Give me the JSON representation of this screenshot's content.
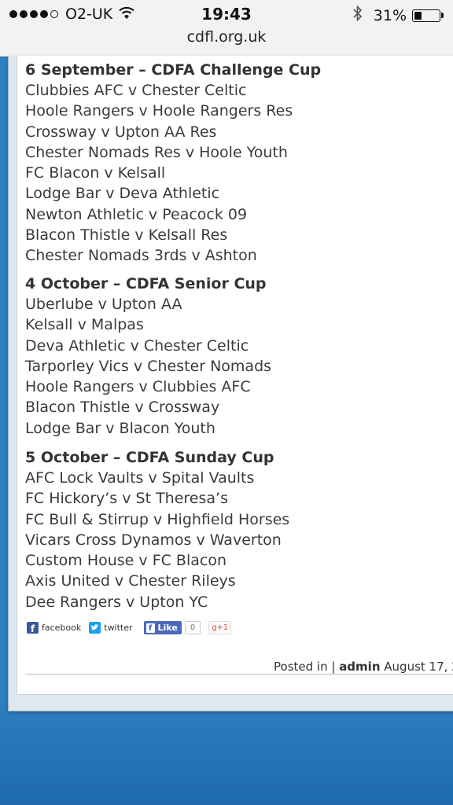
{
  "status_bar": {
    "carrier": "O2-UK",
    "signal_bars_filled": 4,
    "signal_bars_total": 5,
    "time": "19:43",
    "battery": "31%",
    "battery_level": 0.31
  },
  "browser": {
    "url": "cdfl.org.uk"
  },
  "fixtures": [
    {
      "heading": "6 September – CDFA Challenge Cup",
      "matches": [
        "Clubbies AFC v Chester Celtic",
        "Hoole Rangers v Hoole Rangers Res",
        "Crossway v Upton AA Res",
        "Chester Nomads Res v Hoole Youth",
        "FC Blacon v Kelsall",
        "Lodge Bar v Deva Athletic",
        "Newton Athletic v Peacock 09",
        "Blacon Thistle v Kelsall Res",
        "Chester Nomads 3rds v Ashton"
      ]
    },
    {
      "heading": "4 October – CDFA Senior Cup",
      "matches": [
        "Uberlube v Upton AA",
        "Kelsall v Malpas",
        "Deva Athletic v Chester Celtic",
        "Tarporley Vics v Chester Nomads",
        "Hoole Rangers v Clubbies AFC",
        "Blacon Thistle v Crossway",
        "Lodge Bar v Blacon Youth"
      ]
    },
    {
      "heading": "5 October – CDFA Sunday Cup",
      "matches": [
        "AFC Lock Vaults v Spital Vaults",
        "FC Hickory’s v St Theresa’s",
        "FC Bull & Stirrup v Highfield Horses",
        "Vicars Cross Dynamos v Waverton",
        "Custom House v FC Blacon",
        "Axis United v Chester Rileys",
        "Dee Rangers v Upton YC"
      ]
    }
  ],
  "share": {
    "facebook_label": "facebook",
    "twitter_label": "twitter",
    "like_label": "Like",
    "like_count": "0",
    "gplus_label": "g+1"
  },
  "post_meta": {
    "posted_in": "Posted in |",
    "author": "admin",
    "date": "August 17, 2"
  }
}
